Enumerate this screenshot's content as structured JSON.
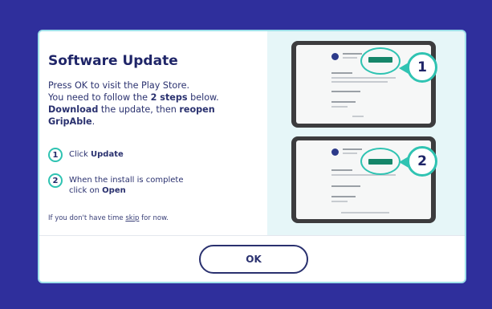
{
  "dialog": {
    "title": "Software Update",
    "intro": {
      "line1": "Press OK to visit the Play Store.",
      "line2_pre": "You need to follow the ",
      "line2_bold": "2 steps",
      "line2_post": " below.",
      "line3_bold1": "Download",
      "line3_mid": " the update, then ",
      "line3_bold2": "reopen GripAble",
      "line3_post": "."
    },
    "steps": [
      {
        "number": "1",
        "text_pre": "Click ",
        "text_bold": "Update"
      },
      {
        "number": "2",
        "text_line1": "When the install is complete",
        "text_pre": "click on ",
        "text_bold": "Open"
      }
    ],
    "skip": {
      "pre": "If you don't have time ",
      "link": "skip",
      "post": " for now."
    },
    "callouts": [
      "1",
      "2"
    ],
    "ok_label": "OK"
  },
  "colors": {
    "background": "#2f2f9c",
    "accent": "#2fc3b2",
    "text": "#242a6b",
    "panel": "#e6f6f8",
    "install_button": "#15866a"
  },
  "icons": [
    "tablet-screenshot",
    "callout-arrow"
  ]
}
